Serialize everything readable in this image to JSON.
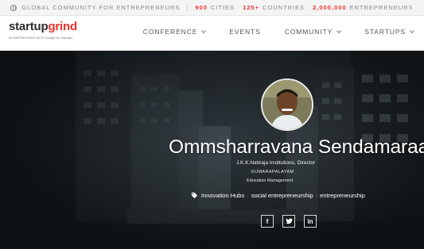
{
  "topbar": {
    "global_label": "GLOBAL COMMUNITY FOR ENTREPRENEURS",
    "separator": "|",
    "cities_num": "900",
    "cities_label": "CITIES",
    "countries_num": "125+",
    "countries_label": "COUNTRIES",
    "entrepreneurs_num": "2,000,000",
    "entrepreneurs_label": "ENTREPRENEURS"
  },
  "logo": {
    "start": "startup",
    "grind": "grind",
    "sub": "IN PARTNERSHIP WITH Google for Startups"
  },
  "nav": {
    "items": [
      {
        "label": "CONFERENCE",
        "dropdown": true
      },
      {
        "label": "EVENTS",
        "dropdown": false
      },
      {
        "label": "COMMUNITY",
        "dropdown": true
      },
      {
        "label": "STARTUPS",
        "dropdown": true
      }
    ]
  },
  "profile": {
    "name": "Ommsharravana Sendamaraai",
    "role": "J.K.K.Nattraja Institutions, Director",
    "location": "KUMARAPALAYAM",
    "industry": "Education Management",
    "tags": [
      "Innovation Hubs",
      "social entrepreneurship",
      "entrepreneurship"
    ],
    "tag_separator": "·",
    "social": [
      {
        "icon": "facebook-icon",
        "glyph": "f"
      },
      {
        "icon": "twitter-icon",
        "glyph": "t"
      },
      {
        "icon": "linkedin-icon",
        "glyph": "in"
      }
    ]
  },
  "colors": {
    "brand_red": "#e8322c",
    "hero_dark": "#1e252a"
  }
}
